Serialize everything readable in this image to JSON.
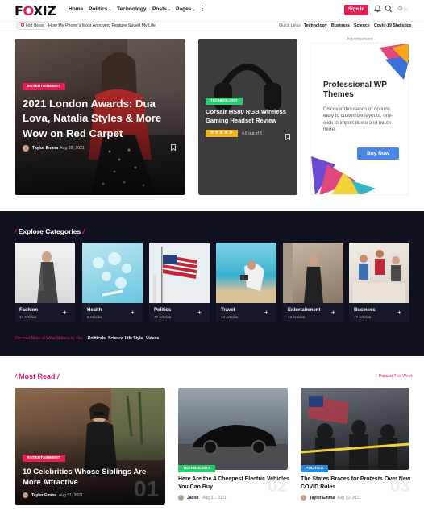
{
  "header": {
    "logo": "F",
    "logo_mid": "O",
    "logo_end": "XIZ",
    "nav": [
      {
        "label": "Home",
        "caret": false
      },
      {
        "label": "Politics",
        "caret": true
      },
      {
        "label": "Technology",
        "caret": true
      },
      {
        "label": "Posts",
        "caret": true
      },
      {
        "label": "Pages",
        "caret": true
      }
    ],
    "signin_label": "Sign In"
  },
  "ticker": {
    "hot_label": "Hot News",
    "headline": "How My Phone's Most Annoying Feature Saved My Life",
    "quick_links_label": "Quick Links",
    "quick_links": [
      "Technology",
      "Business",
      "Science",
      "Covid-19 Statistics"
    ]
  },
  "hero": {
    "main": {
      "category": "ENTERTAINMENT",
      "title": "2021 London Awards: Dua Lova, Natalia Styles & More Wow on Red Carpet",
      "author": "Taylor Emma",
      "date": "Aug 28, 2021"
    },
    "second": {
      "category": "TECHNOLOGY",
      "title": "Corsair HS80 RGB Wireless Gaming Headset Review",
      "rating": "4.8 out of 5"
    },
    "ad": {
      "label": "- Advertisement -",
      "title": "Professional WP Themes",
      "text": "Discover thousands of options, easy to customize layouts, one-click to import demo and much more.",
      "button": "Buy Now"
    }
  },
  "categories": {
    "title": "Explore Categories",
    "items": [
      {
        "name": "Fashion",
        "count": "14 Articles"
      },
      {
        "name": "Health",
        "count": "9 Articles"
      },
      {
        "name": "Politics",
        "count": "12 Articles"
      },
      {
        "name": "Travel",
        "count": "14 Articles"
      },
      {
        "name": "Entertainment",
        "count": "13 Articles"
      },
      {
        "name": "Business",
        "count": "12 Articles"
      }
    ],
    "discover_label": "Discover More of What Matters to You:",
    "discover_links": [
      "Politicals",
      "Science",
      "Life Style",
      "Videos"
    ]
  },
  "most_read": {
    "title": "Most Read",
    "popular_label": "Popular This Week",
    "items": [
      {
        "category": "ENTERTAINMENT",
        "title": "10 Celebrities Whose Siblings Are More Attractive",
        "author": "Taylor Emma",
        "date": "Aug 31, 2021",
        "num": "01"
      },
      {
        "category": "TECHNOLOGY",
        "title": "Here Are the 4 Cheapest Electric Vehicles You Can Buy",
        "author": "Jacob",
        "date": "Aug 31, 2021",
        "num": "02"
      },
      {
        "category": "POLITICS",
        "title": "The States Braces for Protests Over New COVID Rules",
        "author": "Taylor Emma",
        "date": "Aug 19, 2021",
        "num": "03"
      }
    ]
  },
  "colors": {
    "accent": "#e21e52",
    "tech": "#2ec971",
    "politics": "#2b8bdb",
    "dark_bg": "#0f1121"
  }
}
